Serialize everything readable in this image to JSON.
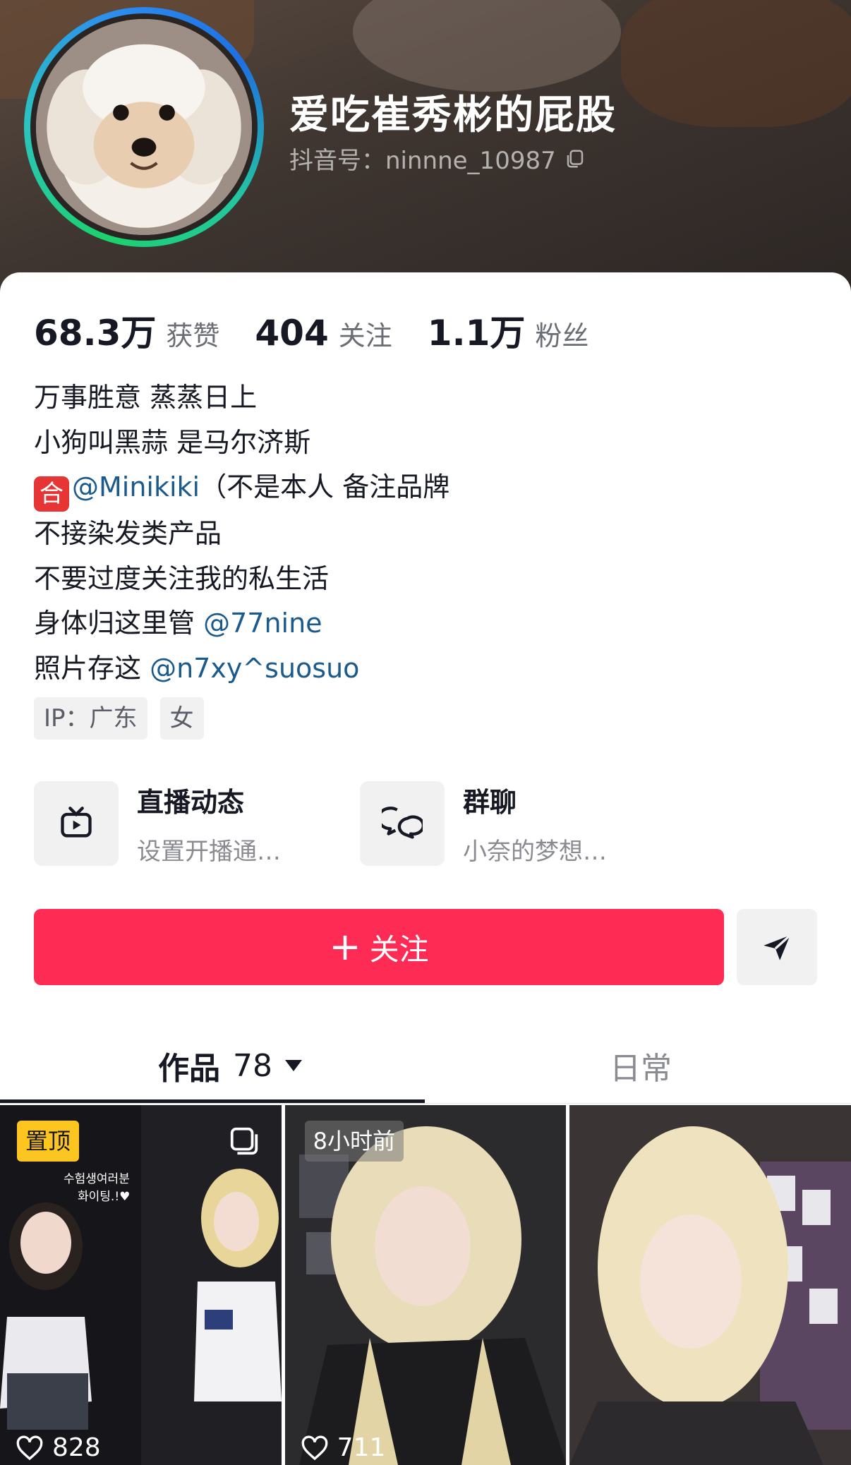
{
  "profile": {
    "nickname": "爱吃崔秀彬的屁股",
    "douyin_id": "抖音号：ninnne_10987"
  },
  "stats": [
    {
      "value": "68.3万",
      "label": "获赞"
    },
    {
      "value": "404",
      "label": "关注"
    },
    {
      "value": "1.1万",
      "label": "粉丝"
    }
  ],
  "bio": {
    "line1": "万事胜意 蒸蒸日上",
    "line2": "小狗叫黑蒜 是马尔济斯",
    "line3_badge": "合",
    "line3_mention": "@Minikiki",
    "line3_text": "（不是本人 备注品牌",
    "line4": "不接染发类产品",
    "line5": "不要过度关注我的私生活",
    "line6_text": "身体归这里管 ",
    "line6_mention": "@77nine",
    "line7_text": "照片存这 ",
    "line7_mention": "@n7xy^suosuo"
  },
  "tags": [
    "IP：广东",
    "女"
  ],
  "entries": [
    {
      "title": "直播动态",
      "subtitle": "设置开播通…",
      "icon": "tv-icon"
    },
    {
      "title": "群聊",
      "subtitle": "小奈的梦想…",
      "icon": "chat-bubbles-icon"
    }
  ],
  "actions": {
    "follow_plus": "+",
    "follow_label": "关注",
    "share_icon": "send-icon"
  },
  "tabs": {
    "works_label": "作品",
    "works_count": "78",
    "daily_label": "日常"
  },
  "videos": [
    {
      "badge": "置顶",
      "likes": "828",
      "multi": true
    },
    {
      "badge": "8小时前",
      "likes": "711"
    },
    {
      "likes": ""
    }
  ],
  "colors": {
    "accent": "#fe2c55",
    "mention": "#1a5a8c",
    "pin_badge": "#fcc51f"
  }
}
